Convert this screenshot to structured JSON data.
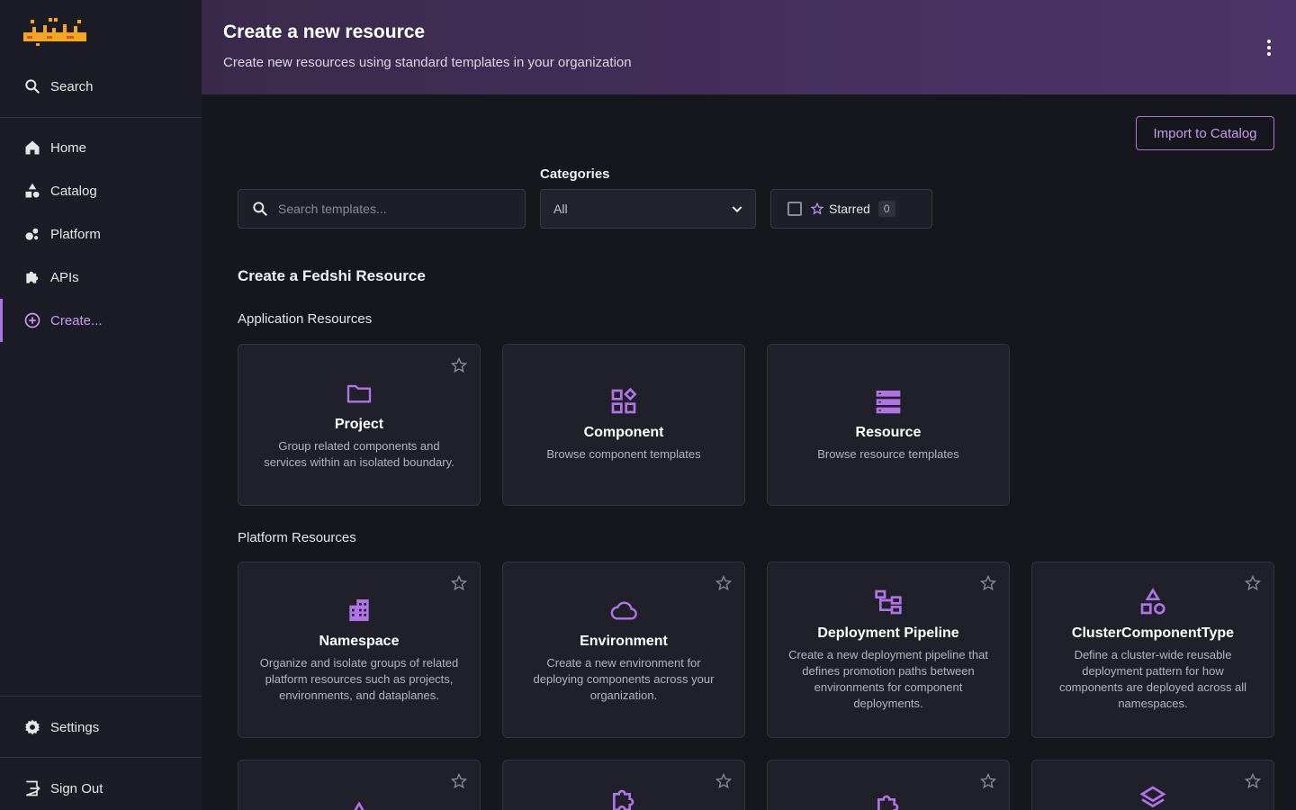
{
  "sidebar": {
    "logo_text": "فدشي",
    "search_label": "Search",
    "items": [
      {
        "label": "Home"
      },
      {
        "label": "Catalog"
      },
      {
        "label": "Platform"
      },
      {
        "label": "APIs"
      },
      {
        "label": "Create..."
      }
    ],
    "settings_label": "Settings",
    "signout_label": "Sign Out"
  },
  "header": {
    "title": "Create a new resource",
    "subtitle": "Create new resources using standard templates in your organization"
  },
  "toolbar": {
    "import_label": "Import to Catalog",
    "search_placeholder": "Search templates...",
    "categories_label": "Categories",
    "categories_value": "All",
    "starred_label": "Starred",
    "starred_count": "0"
  },
  "main": {
    "section_title": "Create a Fedshi Resource",
    "groups": [
      {
        "title": "Application Resources",
        "cards": [
          {
            "title": "Project",
            "desc": "Group related components and services within an isolated boundary."
          },
          {
            "title": "Component",
            "desc": "Browse component templates"
          },
          {
            "title": "Resource",
            "desc": "Browse resource templates"
          }
        ]
      },
      {
        "title": "Platform Resources",
        "cards": [
          {
            "title": "Namespace",
            "desc": "Organize and isolate groups of related platform resources such as projects, environments, and dataplanes."
          },
          {
            "title": "Environment",
            "desc": "Create a new environment for deploying components across your organization."
          },
          {
            "title": "Deployment Pipeline",
            "desc": "Create a new deployment pipeline that defines promotion paths between environments for component deployments."
          },
          {
            "title": "ClusterComponentType",
            "desc": "Define a cluster-wide reusable deployment pattern for how components are deployed across all namespaces."
          }
        ]
      }
    ]
  },
  "colors": {
    "accent": "#b074e6",
    "brand": "#f5a623",
    "header_gradient_end": "#4d3468"
  },
  "icons": [
    "search-icon",
    "home-icon",
    "catalog-icon",
    "platform-icon",
    "apis-icon",
    "create-icon",
    "settings-icon",
    "signout-icon",
    "kebab-icon",
    "star-icon",
    "folder-icon",
    "component-icon",
    "resource-icon",
    "namespace-icon",
    "cloud-icon",
    "pipeline-icon",
    "shapes-icon",
    "warning-icon",
    "puzzle-icon",
    "layers-icon"
  ]
}
